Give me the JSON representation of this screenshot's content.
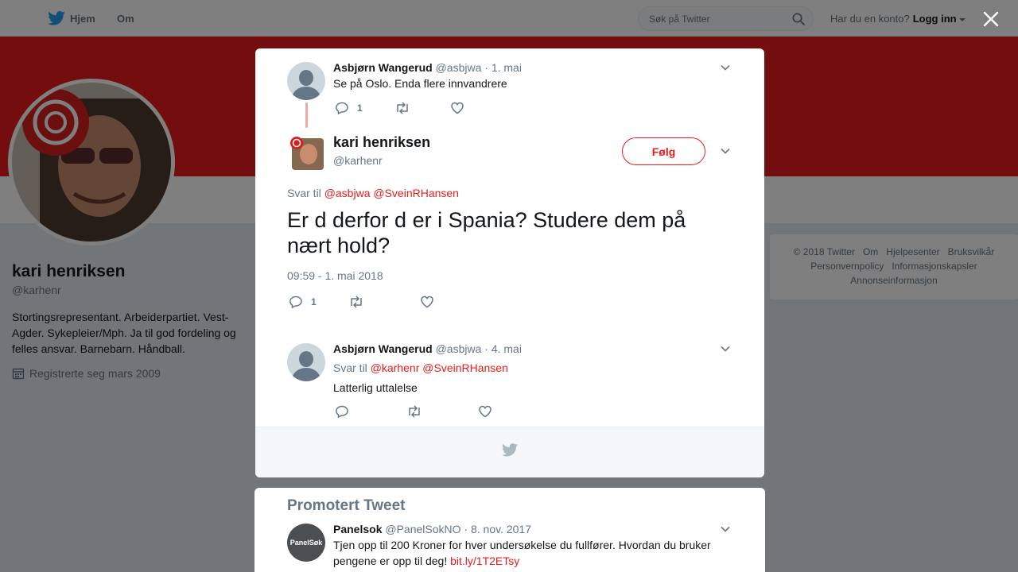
{
  "topbar": {
    "home_label": "Hjem",
    "about_label": "Om",
    "search_placeholder": "Søk på Twitter",
    "account_prompt": "Har du en konto?",
    "login_label": "Logg inn"
  },
  "profile": {
    "name": "kari henriksen",
    "handle": "@karhenr",
    "bio": "Stortingsrepresentant. Arbeiderpartiet. Vest-Agder. Sykepleier/Mph. Ja til god fordeling og felles ansvar. Barnebarn. Håndball.",
    "joined": "Registrerte seg mars 2009"
  },
  "footer_links": [
    "© 2018 Twitter",
    "Om",
    "Hjelpesenter",
    "Bruksvilkår",
    "Personvernpolicy",
    "Informasjonskapsler",
    "Annonseinformasjon"
  ],
  "colors": {
    "brand_red": "#e81c1c",
    "twitter_blue": "#1da1f2",
    "muted": "#657786"
  },
  "parent_tweet": {
    "name": "Asbjørn Wangerud",
    "handle": "@asbjwa",
    "date": "· 1. mai",
    "text": "Se på Oslo. Enda flere innvandrere",
    "reply_count": "1"
  },
  "main_tweet": {
    "name": "kari henriksen",
    "handle": "@karhenr",
    "follow_label": "Følg",
    "reply_to_prefix": "Svar til",
    "reply_to_1": "@asbjwa",
    "reply_to_2": "@SveinRHansen",
    "text": "Er d derfor d er i Spania? Studere dem på nært hold?",
    "timestamp": "09:59 - 1. mai 2018",
    "reply_count": "1"
  },
  "reply_tweet": {
    "name": "Asbjørn Wangerud",
    "handle": "@asbjwa",
    "date": "· 4. mai",
    "reply_to_prefix": "Svar til",
    "reply_to_1": "@karhenr",
    "reply_to_2": "@SveinRHansen",
    "text": "Latterlig uttalelse"
  },
  "promoted": {
    "title": "Promotert Tweet",
    "avatar_label": "PanelSøk",
    "name": "Panelsok",
    "handle": "@PanelSokNO",
    "date": "· 8. nov. 2017",
    "text": "Tjen opp til 200 Kroner for hver undersøkelse du fullfører. Hvordan du bruker pengene er opp til deg!",
    "link": "bit.ly/1T2ETsy"
  }
}
